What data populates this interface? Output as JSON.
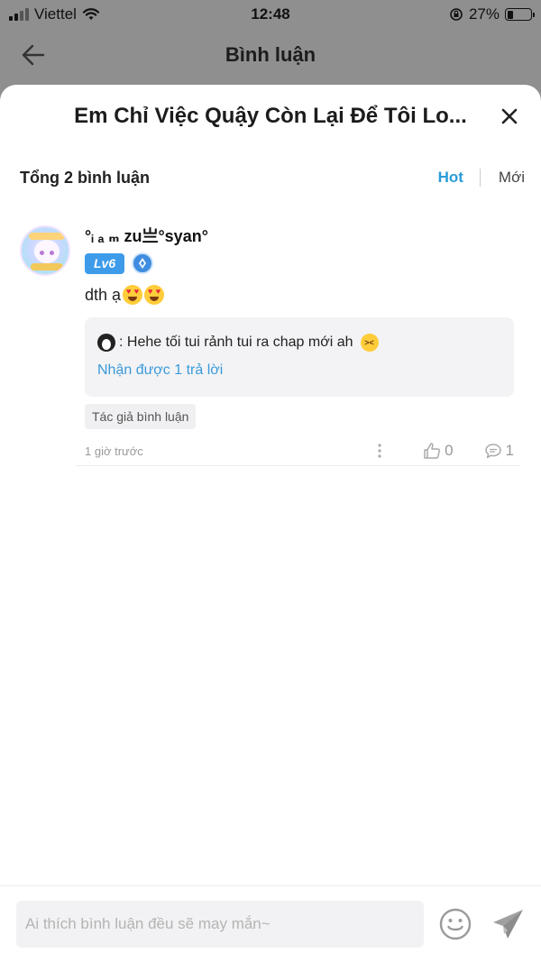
{
  "status_bar": {
    "carrier": "Viettel",
    "time": "12:48",
    "battery": "27%",
    "battery_level": 0.27
  },
  "nav": {
    "title": "Bình luận"
  },
  "sheet": {
    "title": "Em Chỉ Việc Quậy Còn Lại Để Tôi Lo..."
  },
  "summary": {
    "total": "Tổng 2 bình luận",
    "sort_hot": "Hot",
    "sort_new": "Mới"
  },
  "comment": {
    "username": "°ᵢ ₐ ₘ zu亗°syan°",
    "level": "Lv6",
    "text": "dth ạ",
    "reply": {
      "text": ": Hehe tối tui rảnh tui ra chap mới ah",
      "link": "Nhận được 1 trả lời"
    },
    "author_tag": "Tác giả bình luận",
    "time": "1 giờ trước",
    "likes": "0",
    "replies": "1"
  },
  "input": {
    "placeholder": "Ai thích bình luận đều sẽ may mắn~"
  },
  "colors": {
    "accent": "#2a9bd8",
    "level_badge": "#3d9be9"
  }
}
